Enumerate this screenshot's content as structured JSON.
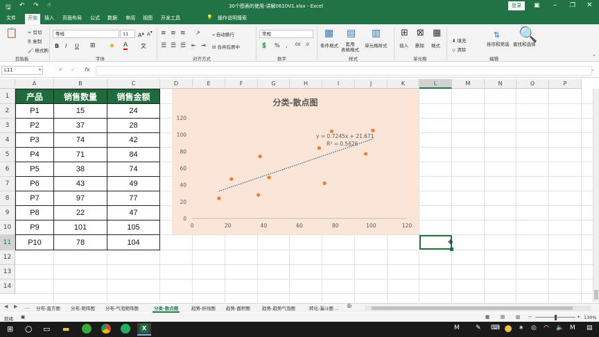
{
  "window": {
    "title": "30个图表的使用-讲解0610V1.xlsx - Excel",
    "login": "登录"
  },
  "tabs": [
    "文件",
    "开始",
    "插入",
    "页面布局",
    "公式",
    "数据",
    "审阅",
    "视图",
    "开发工具"
  ],
  "tell_me": "操作说明搜索",
  "ribbon": {
    "cut": "剪切",
    "copy": "复制",
    "format_painter": "格式刷",
    "clipboard_group": "剪贴板",
    "font_name": "等线",
    "font_size": "11",
    "font_group": "字体",
    "bold": "B",
    "italic": "I",
    "underline": "U",
    "wrap_text": "自动换行",
    "merge_center": "合并后居中",
    "align_group": "对齐方式",
    "number_format": "常规",
    "number_group": "数字",
    "cond_format": "条件格式",
    "table_format": "套用\n表格格式",
    "cell_styles": "单元格样式",
    "styles_group": "样式",
    "insert": "插入",
    "delete": "删除",
    "format": "格式",
    "cells_group": "单元格",
    "fill": "填充",
    "clear": "清除",
    "sort_filter": "排序和筛选",
    "find_select": "查找和选择",
    "edit_group": "编辑"
  },
  "namebox": "L11",
  "fx": "fx",
  "columns": [
    "A",
    "B",
    "C",
    "D",
    "E",
    "F",
    "G",
    "H",
    "I",
    "J",
    "K",
    "L",
    "M",
    "N",
    "O",
    "P"
  ],
  "rows": [
    "1",
    "2",
    "3",
    "4",
    "5",
    "6",
    "7",
    "8",
    "9",
    "10",
    "11",
    "12",
    "13",
    "14"
  ],
  "table": {
    "headers": [
      "产品",
      "销售数量",
      "销售金额"
    ],
    "rows": [
      [
        "P1",
        "15",
        "24"
      ],
      [
        "P2",
        "37",
        "28"
      ],
      [
        "P3",
        "74",
        "42"
      ],
      [
        "P4",
        "71",
        "84"
      ],
      [
        "P5",
        "38",
        "74"
      ],
      [
        "P6",
        "43",
        "49"
      ],
      [
        "P7",
        "97",
        "77"
      ],
      [
        "P8",
        "22",
        "47"
      ],
      [
        "P9",
        "101",
        "105"
      ],
      [
        "P10",
        "78",
        "104"
      ]
    ]
  },
  "chart_data": {
    "type": "scatter",
    "title": "分类-散点图",
    "x": [
      15,
      37,
      74,
      71,
      38,
      43,
      97,
      22,
      101,
      78
    ],
    "y": [
      24,
      28,
      42,
      84,
      74,
      49,
      77,
      47,
      105,
      104
    ],
    "xlim": [
      0,
      120
    ],
    "ylim": [
      0,
      120
    ],
    "xticks": [
      "0",
      "20",
      "40",
      "60",
      "80",
      "100",
      "120"
    ],
    "yticks": [
      "0",
      "20",
      "40",
      "60",
      "80",
      "100",
      "120"
    ],
    "trendline": {
      "slope": 0.7245,
      "intercept": 21.671,
      "equation": "y = 0.7245x + 21.671",
      "r2": "R² = 0.5626"
    },
    "colors": {
      "background": "#fbe5d6",
      "marker": "#ed7d31",
      "trend": "#2e6f9e"
    },
    "grid": false
  },
  "sheets": [
    "...",
    "分布-直方图",
    "分布-矩阵图",
    "分布-气泡矩阵图",
    "分类-散点图",
    "趋势-折线图",
    "趋势-面积图",
    "趋势-趋势气泡图",
    "转化-漏斗图 ..."
  ],
  "status": {
    "ready": "就绪",
    "zoom": "130%"
  }
}
